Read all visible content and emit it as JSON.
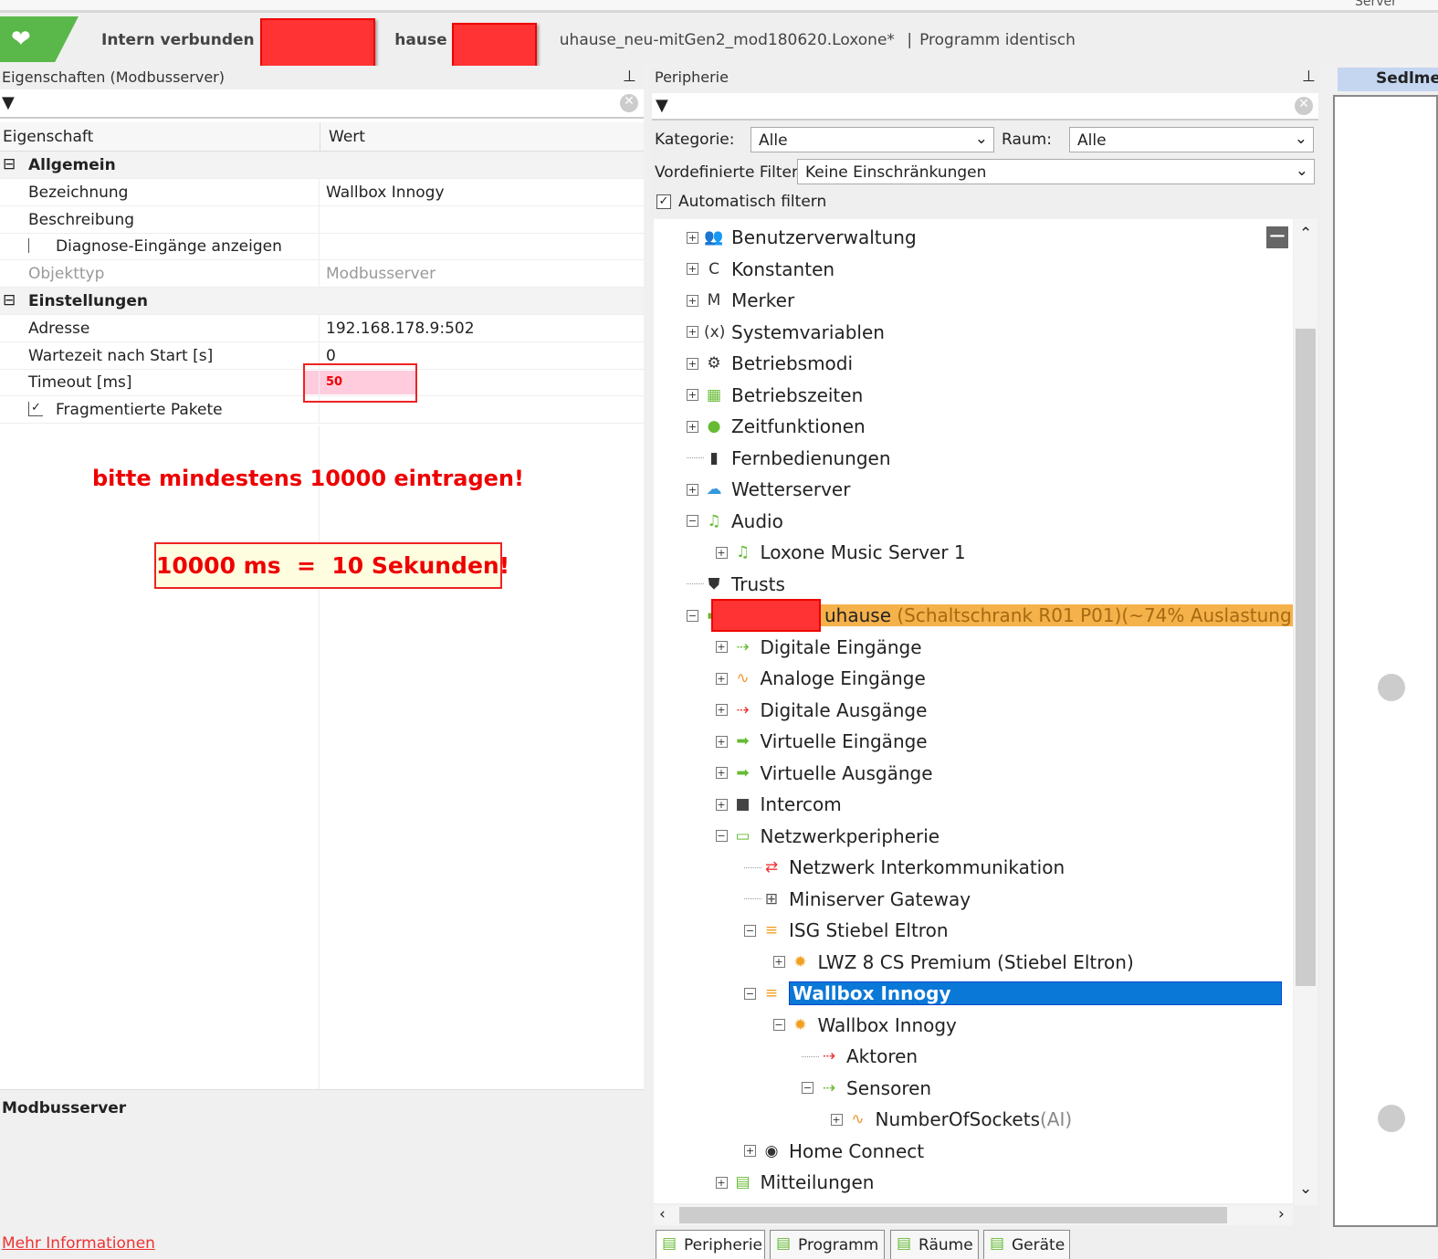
{
  "top": {
    "server_label": "Server",
    "status_a": "Intern verbunden m",
    "status_b": "hause",
    "status_sep": "|",
    "file": "uhause_neu-mitGen2_mod180620.Loxone*",
    "program": "Programm identisch"
  },
  "props": {
    "title": "Eigenschaften (Modbusserver)",
    "col_prop": "Eigenschaft",
    "col_val": "Wert",
    "rows": [
      {
        "k": "Allgemein",
        "v": "",
        "group": true
      },
      {
        "k": "Bezeichnung",
        "v": "Wallbox Innogy"
      },
      {
        "k": "Beschreibung",
        "v": ""
      },
      {
        "k": "Diagnose-Eingänge anzeigen",
        "v": "",
        "checkbox": false
      },
      {
        "k": "Objekttyp",
        "v": "Modbusserver",
        "grey": true
      },
      {
        "k": "Einstellungen",
        "v": "",
        "group": true
      },
      {
        "k": "Adresse",
        "v": "192.168.178.9:502"
      },
      {
        "k": "Wartezeit nach Start [s]",
        "v": "0"
      },
      {
        "k": "Timeout [ms]",
        "v": "50",
        "highlight": true
      },
      {
        "k": "Fragmentierte Pakete",
        "v": "",
        "checkbox": true
      }
    ],
    "note1": "bitte mindestens 10000 eintragen!",
    "note2": "10000 ms  =  10 Sekunden!",
    "desc_title": "Modbusserver",
    "more_link": "Mehr Informationen"
  },
  "peri": {
    "title": "Peripherie",
    "kategorie_label": "Kategorie:",
    "kategorie": "Alle",
    "raum_label": "Raum:",
    "raum": "Alle",
    "filter_label": "Vordefinierte Filter",
    "filter": "Keine Einschränkungen",
    "auto_filter": "Automatisch filtern",
    "tree": [
      {
        "l": 0,
        "e": "+",
        "i": "👥",
        "c": "#2a7",
        "t": "Benutzerverwaltung"
      },
      {
        "l": 0,
        "e": "+",
        "i": "C",
        "c": "#333",
        "t": "Konstanten"
      },
      {
        "l": 0,
        "e": "+",
        "i": "M",
        "c": "#333",
        "t": "Merker"
      },
      {
        "l": 0,
        "e": "+",
        "i": "(x)",
        "c": "#333",
        "t": "Systemvariablen"
      },
      {
        "l": 0,
        "e": "+",
        "i": "⚙",
        "c": "#333",
        "t": "Betriebsmodi"
      },
      {
        "l": 0,
        "e": "+",
        "i": "▦",
        "c": "#6b3",
        "t": "Betriebszeiten"
      },
      {
        "l": 0,
        "e": "+",
        "i": "●",
        "c": "#6b3",
        "t": "Zeitfunktionen"
      },
      {
        "l": 0,
        "e": "",
        "i": "▮",
        "c": "#333",
        "t": "Fernbedienungen"
      },
      {
        "l": 0,
        "e": "+",
        "i": "☁",
        "c": "#39d",
        "t": "Wetterserver"
      },
      {
        "l": 0,
        "e": "-",
        "i": "♫",
        "c": "#6b3",
        "t": "Audio"
      },
      {
        "l": 1,
        "e": "+",
        "i": "♫",
        "c": "#6b3",
        "t": "Loxone Music Server 1"
      },
      {
        "l": 0,
        "e": "",
        "i": "⛊",
        "c": "#333",
        "t": "Trusts"
      },
      {
        "l": 0,
        "e": "-",
        "i": "▬",
        "c": "#6b3",
        "t": "uhause",
        "t2": " (Schaltschrank R01 P01)(~74% Auslastung)",
        "hl": true
      },
      {
        "l": 1,
        "e": "+",
        "i": "⇢",
        "c": "#6b3",
        "t": "Digitale Eingänge"
      },
      {
        "l": 1,
        "e": "+",
        "i": "∿",
        "c": "#e93",
        "t": "Analoge Eingänge"
      },
      {
        "l": 1,
        "e": "+",
        "i": "⇢",
        "c": "#e33",
        "t": "Digitale Ausgänge"
      },
      {
        "l": 1,
        "e": "+",
        "i": "➡",
        "c": "#6b3",
        "t": "Virtuelle Eingänge"
      },
      {
        "l": 1,
        "e": "+",
        "i": "➡",
        "c": "#6b3",
        "t": "Virtuelle Ausgänge"
      },
      {
        "l": 1,
        "e": "+",
        "i": "■",
        "c": "#444",
        "t": "Intercom"
      },
      {
        "l": 1,
        "e": "-",
        "i": "▭",
        "c": "#6b3",
        "t": "Netzwerkperipherie"
      },
      {
        "l": 2,
        "e": "",
        "i": "⇄",
        "c": "#e33",
        "t": "Netzwerk Interkommunikation"
      },
      {
        "l": 2,
        "e": "",
        "i": "⊞",
        "c": "#555",
        "t": "Miniserver Gateway"
      },
      {
        "l": 2,
        "e": "-",
        "i": "≡",
        "c": "#f0a020",
        "t": "ISG Stiebel Eltron"
      },
      {
        "l": 3,
        "e": "+",
        "i": "✹",
        "c": "#f0a020",
        "t": "LWZ 8 CS Premium (Stiebel Eltron)"
      },
      {
        "l": 2,
        "e": "-",
        "i": "≡",
        "c": "#f0a020",
        "t": "Wallbox Innogy",
        "sel": true
      },
      {
        "l": 3,
        "e": "-",
        "i": "✹",
        "c": "#f0a020",
        "t": "Wallbox Innogy"
      },
      {
        "l": 4,
        "e": "",
        "i": "⇢",
        "c": "#e33",
        "t": "Aktoren"
      },
      {
        "l": 4,
        "e": "-",
        "i": "⇢",
        "c": "#6b3",
        "t": "Sensoren"
      },
      {
        "l": 5,
        "e": "+",
        "i": "∿",
        "c": "#e93",
        "t": "NumberOfSockets",
        "t3": " (AI)"
      },
      {
        "l": 2,
        "e": "+",
        "i": "◉",
        "c": "#333",
        "t": "Home Connect"
      },
      {
        "l": 1,
        "e": "+",
        "i": "▤",
        "c": "#6b3",
        "t": "Mitteilungen"
      }
    ],
    "tabs": [
      "Peripherie",
      "Programm",
      "Räume",
      "Geräte"
    ]
  },
  "right": {
    "tab": "Sedlme"
  }
}
